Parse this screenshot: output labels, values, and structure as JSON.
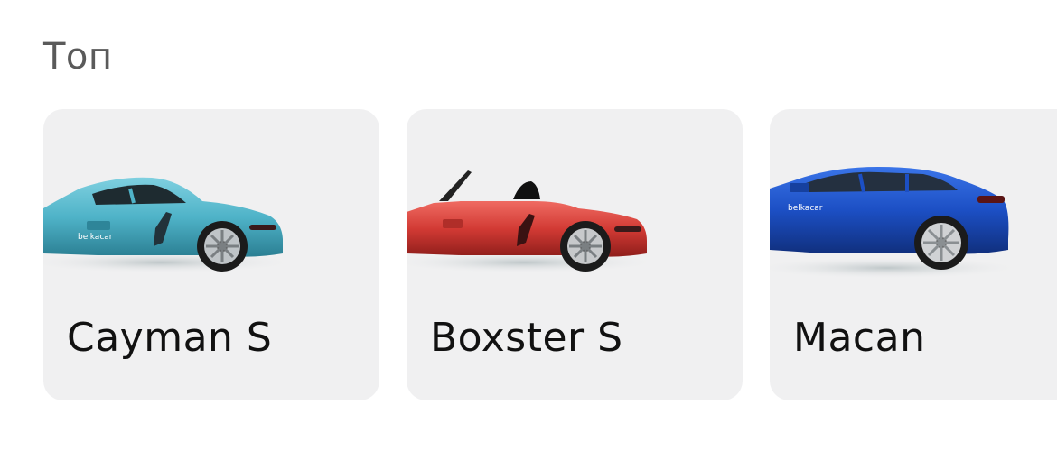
{
  "section": {
    "title": "Топ"
  },
  "cars": [
    {
      "name": "Cayman S",
      "brand_logo": "belkacar",
      "color": "#4fb3c8",
      "image": "car-coupe-icon"
    },
    {
      "name": "Boxster S",
      "brand_logo": "belkacar",
      "color": "#d23a34",
      "image": "car-convertible-icon"
    },
    {
      "name": "Macan",
      "brand_logo": "belkacar",
      "color": "#1c4fc4",
      "image": "car-suv-icon"
    }
  ],
  "colors": {
    "card_background": "#f0f0f1",
    "title_text": "#5a5a5a",
    "card_text": "#111111"
  }
}
